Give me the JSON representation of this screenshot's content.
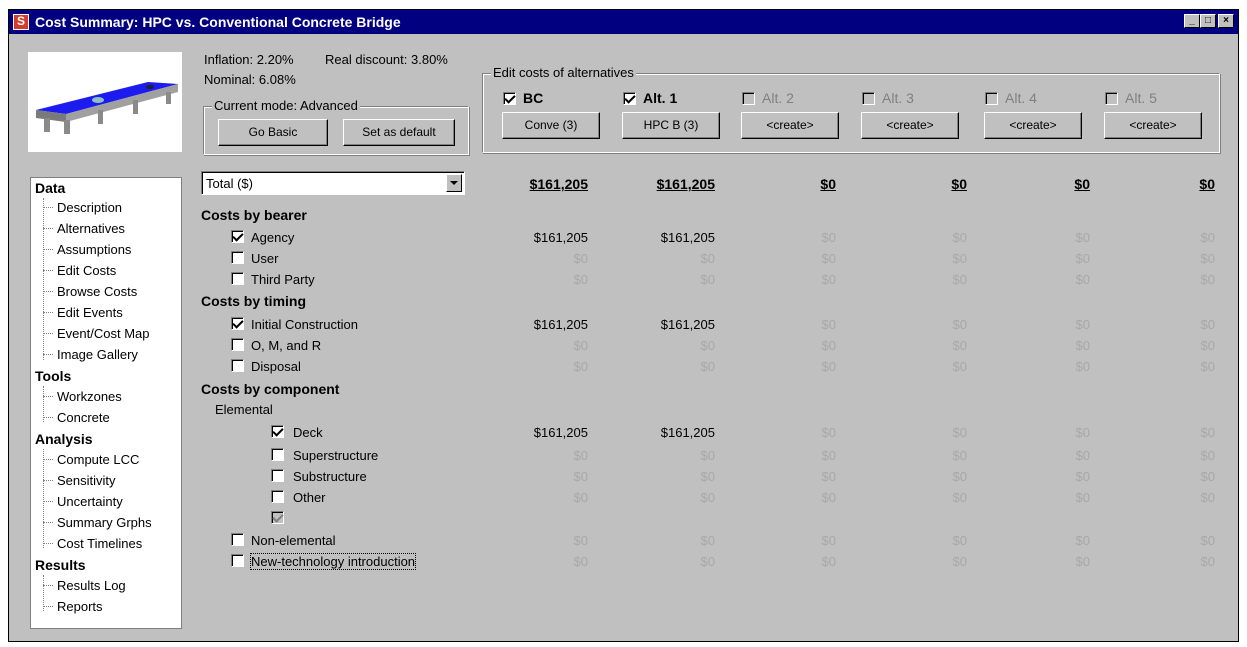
{
  "window": {
    "title": "Cost Summary: HPC vs. Conventional Concrete Bridge",
    "controls": [
      "_",
      "□",
      "×"
    ]
  },
  "rates": {
    "inflation": "Inflation: 2.20%",
    "real_discount": "Real discount: 3.80%",
    "nominal": "Nominal: 6.08%"
  },
  "mode": {
    "group_label": "Current mode: Advanced",
    "go_basic": "Go Basic",
    "set_default": "Set as default"
  },
  "edit_costs": {
    "group_label": "Edit costs of alternatives",
    "alternatives": [
      {
        "label": "BC",
        "checked": true,
        "enabled": true,
        "button": "Conve (3)"
      },
      {
        "label": "Alt. 1",
        "checked": true,
        "enabled": true,
        "button": "HPC B (3)"
      },
      {
        "label": "Alt. 2",
        "checked": false,
        "enabled": false,
        "button": "<create>"
      },
      {
        "label": "Alt. 3",
        "checked": false,
        "enabled": false,
        "button": "<create>"
      },
      {
        "label": "Alt. 4",
        "checked": false,
        "enabled": false,
        "button": "<create>"
      },
      {
        "label": "Alt. 5",
        "checked": false,
        "enabled": false,
        "button": "<create>"
      }
    ]
  },
  "nav": {
    "groups": [
      {
        "title": "Data",
        "items": [
          "Description",
          "Alternatives",
          "Assumptions",
          "Edit Costs",
          "Browse Costs",
          "Edit Events",
          "Event/Cost Map",
          "Image Gallery"
        ]
      },
      {
        "title": "Tools",
        "items": [
          "Workzones",
          "Concrete"
        ]
      },
      {
        "title": "Analysis",
        "items": [
          "Compute LCC",
          "Sensitivity",
          "Uncertainty",
          "Summary Grphs",
          "Cost Timelines"
        ]
      },
      {
        "title": "Results",
        "items": [
          "Results Log",
          "Reports"
        ]
      }
    ]
  },
  "summary": {
    "selector": "Total ($)",
    "totals": [
      "$161,205",
      "$161,205",
      "$0",
      "$0",
      "$0",
      "$0"
    ],
    "bearer_title": "Costs by bearer",
    "timing_title": "Costs by timing",
    "component_title": "Costs by component",
    "elemental_label": "Elemental",
    "rows": {
      "agency": {
        "label": "Agency",
        "checked": true,
        "values": [
          "$161,205",
          "$161,205",
          "$0",
          "$0",
          "$0",
          "$0"
        ]
      },
      "user": {
        "label": "User",
        "checked": false,
        "values": [
          "$0",
          "$0",
          "$0",
          "$0",
          "$0",
          "$0"
        ]
      },
      "third_party": {
        "label": "Third Party",
        "checked": false,
        "values": [
          "$0",
          "$0",
          "$0",
          "$0",
          "$0",
          "$0"
        ]
      },
      "initial": {
        "label": "Initial Construction",
        "checked": true,
        "values": [
          "$161,205",
          "$161,205",
          "$0",
          "$0",
          "$0",
          "$0"
        ]
      },
      "omr": {
        "label": "O, M, and R",
        "checked": false,
        "values": [
          "$0",
          "$0",
          "$0",
          "$0",
          "$0",
          "$0"
        ]
      },
      "disposal": {
        "label": "Disposal",
        "checked": false,
        "values": [
          "$0",
          "$0",
          "$0",
          "$0",
          "$0",
          "$0"
        ]
      },
      "deck": {
        "label": "Deck",
        "checked": true,
        "values": [
          "$161,205",
          "$161,205",
          "$0",
          "$0",
          "$0",
          "$0"
        ]
      },
      "superstructure": {
        "label": "Superstructure",
        "checked": false,
        "values": [
          "$0",
          "$0",
          "$0",
          "$0",
          "$0",
          "$0"
        ]
      },
      "substructure": {
        "label": "Substructure",
        "checked": false,
        "values": [
          "$0",
          "$0",
          "$0",
          "$0",
          "$0",
          "$0"
        ]
      },
      "other": {
        "label": "Other",
        "checked": false,
        "values": [
          "$0",
          "$0",
          "$0",
          "$0",
          "$0",
          "$0"
        ]
      },
      "non_elemental": {
        "label": "Non-elemental",
        "checked": false,
        "values": [
          "$0",
          "$0",
          "$0",
          "$0",
          "$0",
          "$0"
        ]
      },
      "new_tech": {
        "label": "New-technology introduction",
        "checked": false,
        "values": [
          "$0",
          "$0",
          "$0",
          "$0",
          "$0",
          "$0"
        ]
      }
    }
  }
}
